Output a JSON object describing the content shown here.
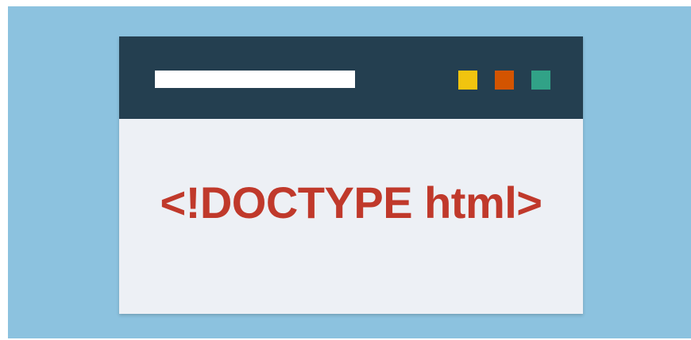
{
  "content": {
    "doctype_text": "<!DOCTYPE html>"
  },
  "colors": {
    "background": "#8cc2df",
    "titlebar": "#243f50",
    "window_body": "#edf0f5",
    "address_bar": "#ffffff",
    "text": "#c0392b",
    "controls": {
      "yellow": "#f1c40f",
      "red": "#d35400",
      "green": "#31a287"
    }
  },
  "window_controls": [
    {
      "name": "minimize-button",
      "icon": "yellow-square-icon",
      "color_key": "yellow"
    },
    {
      "name": "maximize-button",
      "icon": "red-square-icon",
      "color_key": "red"
    },
    {
      "name": "close-button",
      "icon": "green-square-icon",
      "color_key": "green"
    }
  ]
}
